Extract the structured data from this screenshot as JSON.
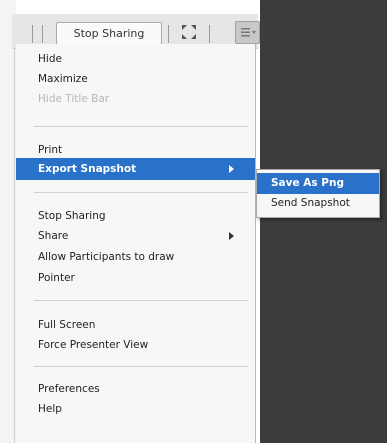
{
  "toolbar": {
    "stop_sharing_label": "Stop Sharing",
    "fullscreen_icon": "fullscreen-icon",
    "menu_icon": "pod-menu-icon"
  },
  "menu": {
    "items": [
      {
        "label": "Hide",
        "enabled": true
      },
      {
        "label": "Maximize",
        "enabled": true
      },
      {
        "label": "Hide Title Bar",
        "enabled": false
      },
      {
        "label": "Print",
        "enabled": true
      },
      {
        "label": "Export Snapshot",
        "enabled": true,
        "submenu": true,
        "active": true
      },
      {
        "label": "Stop Sharing",
        "enabled": true
      },
      {
        "label": "Share",
        "enabled": true,
        "submenu": true
      },
      {
        "label": "Allow Participants to draw",
        "enabled": true
      },
      {
        "label": "Pointer",
        "enabled": true
      },
      {
        "label": "Full Screen",
        "enabled": true
      },
      {
        "label": "Force Presenter View",
        "enabled": true
      },
      {
        "label": "Preferences",
        "enabled": true
      },
      {
        "label": "Help",
        "enabled": true
      }
    ]
  },
  "submenu": {
    "items": [
      {
        "label": "Save As Png",
        "active": true
      },
      {
        "label": "Send Snapshot",
        "active": false
      }
    ]
  },
  "colors": {
    "highlight": "#2a72c9",
    "background_dark": "#3c3c3c",
    "menu_bg": "#f7f7f7"
  }
}
